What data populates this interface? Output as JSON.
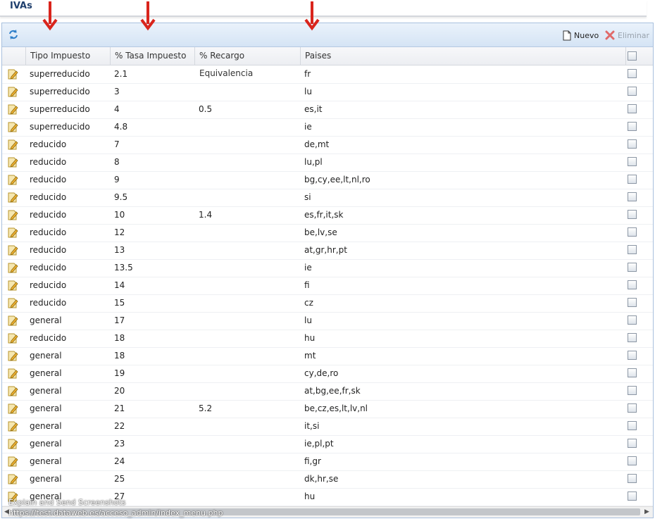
{
  "panel": {
    "title": "IVAs"
  },
  "toolbar": {
    "nuevo_label": "Nuevo",
    "eliminar_label": "Eliminar"
  },
  "columns": {
    "tipo": "Tipo Impuesto",
    "tasa": "% Tasa Impuesto",
    "recargo": "% Recargo Equivalencia",
    "paises": "Paises"
  },
  "rows": [
    {
      "tipo": "superreducido",
      "tasa": "2.1",
      "recargo": "",
      "paises": "fr"
    },
    {
      "tipo": "superreducido",
      "tasa": "3",
      "recargo": "",
      "paises": "lu"
    },
    {
      "tipo": "superreducido",
      "tasa": "4",
      "recargo": "0.5",
      "paises": "es,it"
    },
    {
      "tipo": "superreducido",
      "tasa": "4.8",
      "recargo": "",
      "paises": "ie"
    },
    {
      "tipo": "reducido",
      "tasa": "7",
      "recargo": "",
      "paises": "de,mt"
    },
    {
      "tipo": "reducido",
      "tasa": "8",
      "recargo": "",
      "paises": "lu,pl"
    },
    {
      "tipo": "reducido",
      "tasa": "9",
      "recargo": "",
      "paises": "bg,cy,ee,lt,nl,ro"
    },
    {
      "tipo": "reducido",
      "tasa": "9.5",
      "recargo": "",
      "paises": "si"
    },
    {
      "tipo": "reducido",
      "tasa": "10",
      "recargo": "1.4",
      "paises": "es,fr,it,sk"
    },
    {
      "tipo": "reducido",
      "tasa": "12",
      "recargo": "",
      "paises": "be,lv,se"
    },
    {
      "tipo": "reducido",
      "tasa": "13",
      "recargo": "",
      "paises": "at,gr,hr,pt"
    },
    {
      "tipo": "reducido",
      "tasa": "13.5",
      "recargo": "",
      "paises": "ie"
    },
    {
      "tipo": "reducido",
      "tasa": "14",
      "recargo": "",
      "paises": "fi"
    },
    {
      "tipo": "reducido",
      "tasa": "15",
      "recargo": "",
      "paises": "cz"
    },
    {
      "tipo": "general",
      "tasa": "17",
      "recargo": "",
      "paises": "lu"
    },
    {
      "tipo": "reducido",
      "tasa": "18",
      "recargo": "",
      "paises": "hu"
    },
    {
      "tipo": "general",
      "tasa": "18",
      "recargo": "",
      "paises": "mt"
    },
    {
      "tipo": "general",
      "tasa": "19",
      "recargo": "",
      "paises": "cy,de,ro"
    },
    {
      "tipo": "general",
      "tasa": "20",
      "recargo": "",
      "paises": "at,bg,ee,fr,sk"
    },
    {
      "tipo": "general",
      "tasa": "21",
      "recargo": "5.2",
      "paises": "be,cz,es,lt,lv,nl"
    },
    {
      "tipo": "general",
      "tasa": "22",
      "recargo": "",
      "paises": "it,si"
    },
    {
      "tipo": "general",
      "tasa": "23",
      "recargo": "",
      "paises": "ie,pl,pt"
    },
    {
      "tipo": "general",
      "tasa": "24",
      "recargo": "",
      "paises": "fi,gr"
    },
    {
      "tipo": "general",
      "tasa": "25",
      "recargo": "",
      "paises": "dk,hr,se"
    },
    {
      "tipo": "general",
      "tasa": "27",
      "recargo": "",
      "paises": "hu"
    }
  ],
  "status": {
    "line1": "Explain and Send Screenshots",
    "line2": "https://test.dataweb.es/acceso_admin/index_menu.php"
  },
  "colors": {
    "annotation_arrow": "#d9241c",
    "header_blue": "#20406e"
  }
}
